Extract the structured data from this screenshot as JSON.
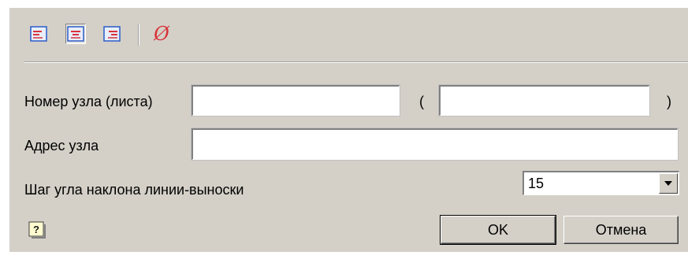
{
  "toolbar": {
    "buttons": [
      {
        "icon": "align-left-icon",
        "pressed": false
      },
      {
        "icon": "align-center-icon",
        "pressed": true
      },
      {
        "icon": "align-right-icon",
        "pressed": false
      },
      {
        "icon": "diameter-icon",
        "pressed": false
      }
    ],
    "diameter_symbol": "Ø"
  },
  "form": {
    "node_number_label": "Номер узла (листа)",
    "node_number_value": "",
    "open_paren": "(",
    "sheet_value": "",
    "close_paren": ")",
    "node_address_label": "Адрес узла",
    "node_address_value": "",
    "angle_step_label": "Шаг угла наклона линии-выноски",
    "angle_step_value": "15"
  },
  "buttons": {
    "ok_label": "OK",
    "cancel_label": "Отмена"
  },
  "colors": {
    "dialog_bg": "#d4d0c8",
    "icon_blue": "#2a5cc9",
    "icon_red": "#d8333a"
  }
}
